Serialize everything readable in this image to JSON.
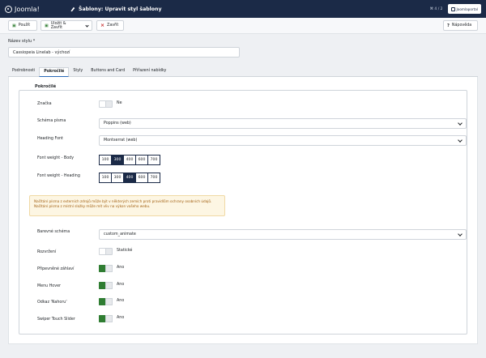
{
  "header": {
    "logo_text": "Joomla!",
    "title": "Šablony: Upravit styl šablony",
    "version": "⌘ 4 / 2",
    "user_button": "Joomlaportal"
  },
  "toolbar": {
    "apply": "Použít",
    "save_close": "Uložit & Zavřít",
    "close": "Zavřít",
    "help": "Nápověda"
  },
  "style_name": {
    "label": "Název stylu *",
    "value": "Cassiopeia Linelab - výchozí"
  },
  "tabs": [
    {
      "label": "Podrobnosti",
      "active": false
    },
    {
      "label": "Pokročilé",
      "active": true
    },
    {
      "label": "Styly",
      "active": false
    },
    {
      "label": "Buttons and Card",
      "active": false
    },
    {
      "label": "Přiřazení nabídky",
      "active": false
    }
  ],
  "fieldset": {
    "legend": "Pokročilé"
  },
  "fields": {
    "brand": {
      "label": "Značka",
      "state": "Ne"
    },
    "font_scheme": {
      "label": "Schéma písma",
      "value": "Poppins (web)"
    },
    "heading_font": {
      "label": "Heading Font",
      "value": "Montserrat (web)"
    },
    "fw_body": {
      "label": "Font weight - Body",
      "options": [
        "100",
        "300",
        "400",
        "600",
        "700"
      ],
      "selected": "300"
    },
    "fw_heading": {
      "label": "Font weight - Heading",
      "options": [
        "100",
        "300",
        "400",
        "600",
        "700"
      ],
      "selected": "400"
    },
    "alert": {
      "line1": "Načítání písma z externích zdrojů může být v některých zemích proti pravidlům ochrany osobních údajů.",
      "line2": "Načítání písma z místní složky může mít vliv na výkon vašeho webu."
    },
    "color_scheme": {
      "label": "Barevné schéma",
      "value": "custom_animate"
    },
    "layout": {
      "label": "Rozvržení",
      "state": "Statické"
    },
    "sticky_header": {
      "label": "Připevněné záhlaví",
      "state": "Ano"
    },
    "menu_hover": {
      "label": "Menu Hover",
      "state": "Ano"
    },
    "back_to_top": {
      "label": "Odkaz 'Nahoru'",
      "state": "Ano"
    },
    "swiper": {
      "label": "Swiper Touch Slider",
      "state": "Ano"
    }
  }
}
